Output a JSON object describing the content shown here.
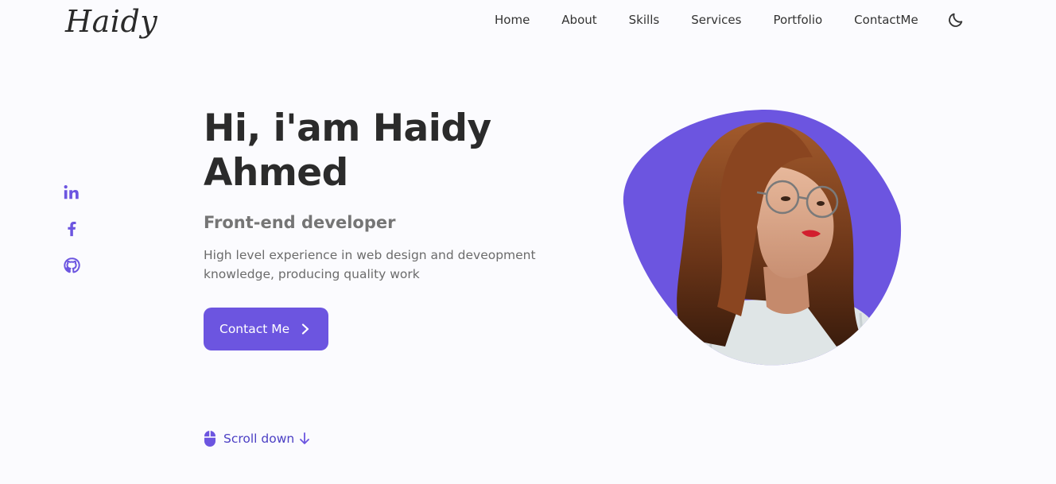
{
  "nav": {
    "logo": "Haidy",
    "links": {
      "home": "Home",
      "about": "About",
      "skills": "Skills",
      "services": "Services",
      "portfolio": "Portfolio",
      "contact": "ContactMe"
    },
    "theme_icon": "moon-icon"
  },
  "social": {
    "icons": [
      "linkedin-icon",
      "facebook-icon",
      "github-icon"
    ]
  },
  "hero": {
    "title": "Hi, i'am Haidy Ahmed",
    "subtitle": "Front-end developer",
    "description": "High level experience in web design and deveopment knowledge, producing quality work",
    "button_label": "Contact Me",
    "button_icon": "chevron-right-icon"
  },
  "scroll": {
    "label": "Scroll down",
    "mouse_icon": "mouse-icon",
    "arrow_icon": "arrow-down-icon"
  },
  "colors": {
    "accent": "#6c55e0",
    "accent_dark": "#4b3fc4",
    "background": "#fbfbfe",
    "heading": "#2b2b2b",
    "text": "#6b6b6b"
  }
}
